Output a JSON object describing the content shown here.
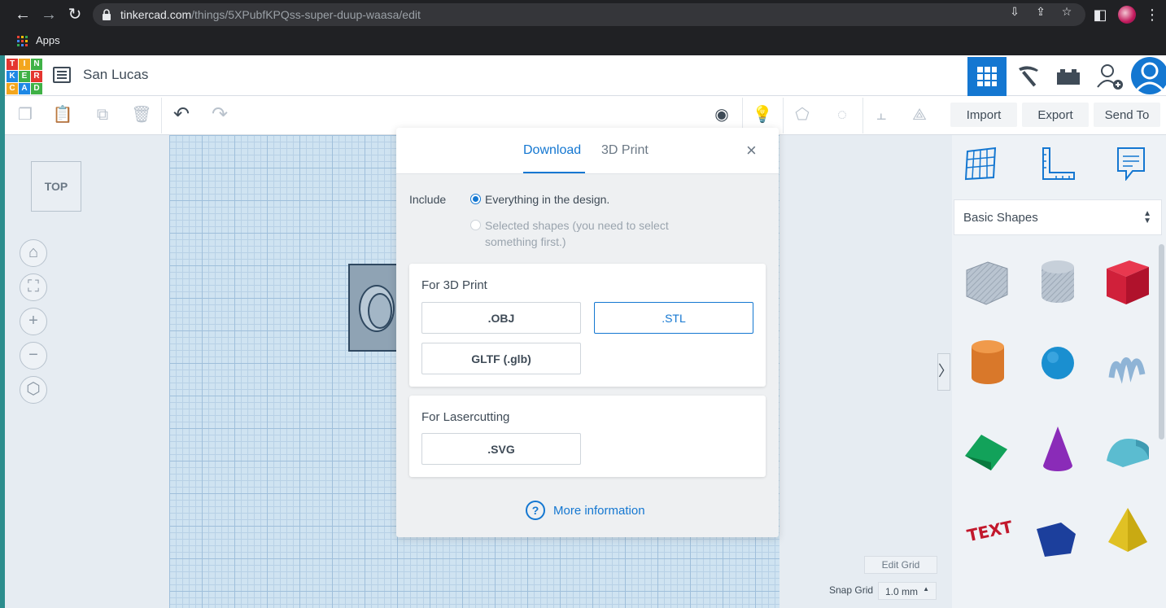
{
  "browser": {
    "url_host": "tinkercad.com",
    "url_path": "/things/5XPubfKPQss-super-duup-waasa/edit",
    "bookmarks": {
      "apps_label": "Apps"
    }
  },
  "app": {
    "logo_letters": [
      "T",
      "I",
      "N",
      "K",
      "E",
      "R",
      "C",
      "A",
      "D"
    ],
    "design_name": "San Lucas",
    "toolbar": {
      "import_label": "Import",
      "export_label": "Export",
      "send_to_label": "Send To"
    },
    "viewcube_label": "TOP",
    "shape_library": {
      "selected": "Basic Shapes"
    },
    "grid": {
      "edit_label": "Edit Grid",
      "snap_label": "Snap Grid",
      "snap_value": "1.0 mm"
    }
  },
  "modal": {
    "tabs": {
      "download": "Download",
      "print": "3D Print"
    },
    "close_label": "×",
    "include": {
      "label": "Include",
      "option_all": "Everything in the design.",
      "option_selected_line1": "Selected shapes (you need to select",
      "option_selected_line2": "something first.)"
    },
    "print_section": {
      "title": "For 3D Print",
      "obj": ".OBJ",
      "stl": ".STL",
      "gltf": "GLTF (.glb)"
    },
    "laser_section": {
      "title": "For Lasercutting",
      "svg": ".SVG"
    },
    "more_info": {
      "icon": "?",
      "label": "More information"
    }
  },
  "colors": {
    "accent": "#1477d1",
    "text": "#3f4b57"
  }
}
